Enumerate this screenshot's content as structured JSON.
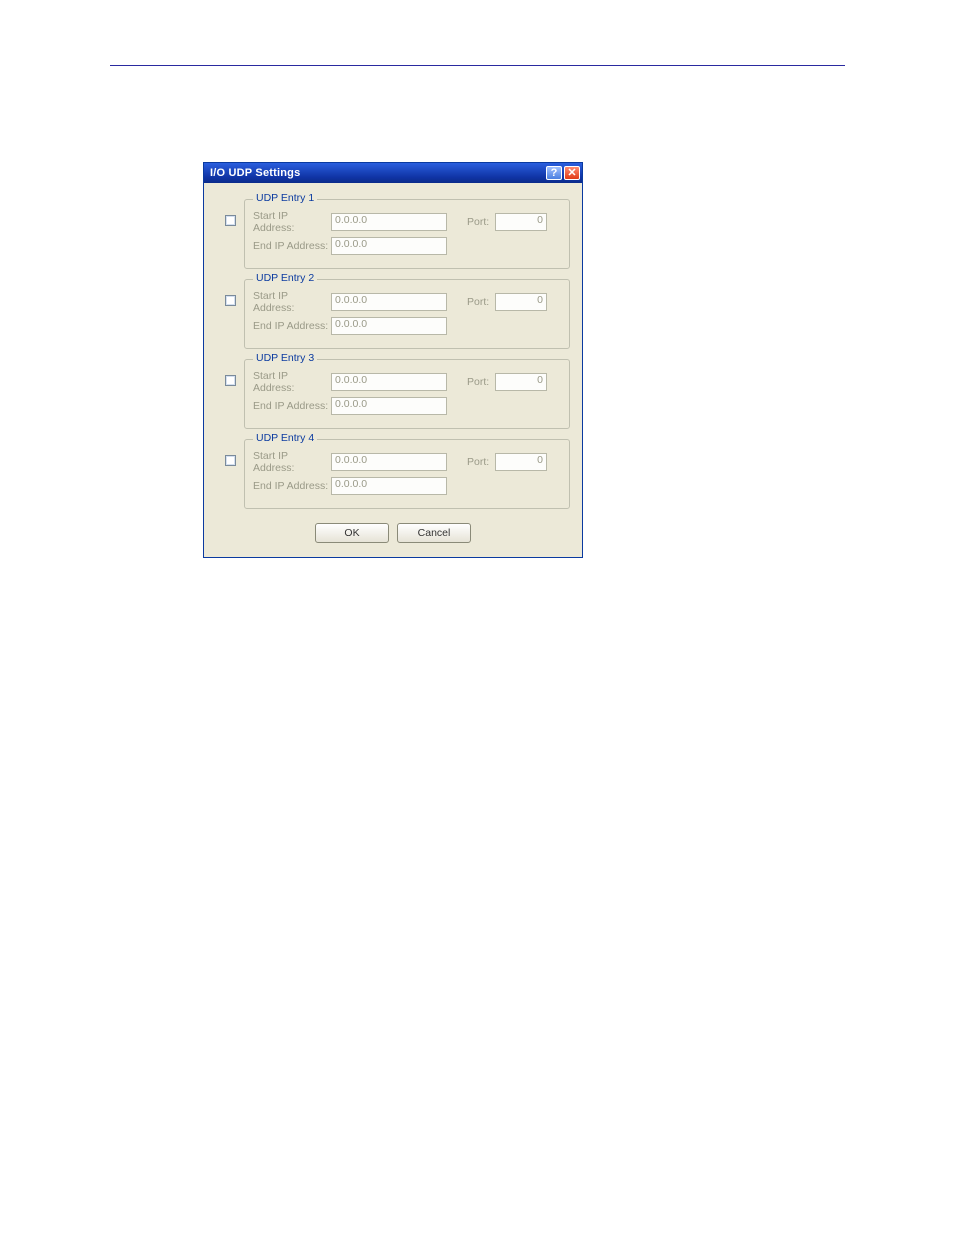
{
  "dialog": {
    "title": "I/O UDP Settings",
    "entries": [
      {
        "legend": "UDP Entry 1",
        "start_label": "Start IP Address:",
        "start_value": "0.0.0.0",
        "end_label": "End IP Address:",
        "end_value": "0.0.0.0",
        "port_label": "Port:",
        "port_value": "0"
      },
      {
        "legend": "UDP Entry 2",
        "start_label": "Start IP Address:",
        "start_value": "0.0.0.0",
        "end_label": "End IP Address:",
        "end_value": "0.0.0.0",
        "port_label": "Port:",
        "port_value": "0"
      },
      {
        "legend": "UDP Entry 3",
        "start_label": "Start IP Address:",
        "start_value": "0.0.0.0",
        "end_label": "End IP Address:",
        "end_value": "0.0.0.0",
        "port_label": "Port:",
        "port_value": "0"
      },
      {
        "legend": "UDP Entry 4",
        "start_label": "Start IP Address:",
        "start_value": "0.0.0.0",
        "end_label": "End IP Address:",
        "end_value": "0.0.0.0",
        "port_label": "Port:",
        "port_value": "0"
      }
    ],
    "buttons": {
      "ok": "OK",
      "cancel": "Cancel"
    },
    "titlebar": {
      "help_glyph": "?",
      "close_glyph": "✕"
    }
  }
}
